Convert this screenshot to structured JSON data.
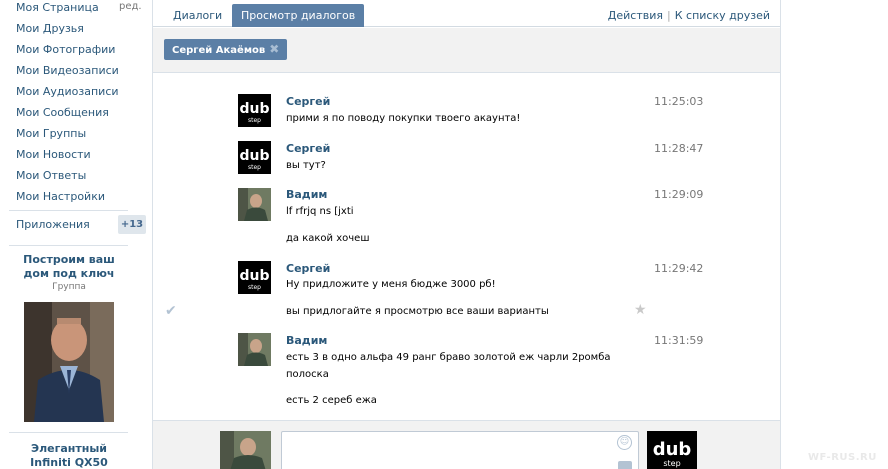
{
  "sidebar": {
    "items": [
      {
        "label": "Моя Страница"
      },
      {
        "label": "Мои Друзья"
      },
      {
        "label": "Мои Фотографии"
      },
      {
        "label": "Мои Видеозаписи"
      },
      {
        "label": "Мои Аудиозаписи"
      },
      {
        "label": "Мои Сообщения"
      },
      {
        "label": "Мои Группы"
      },
      {
        "label": "Мои Новости"
      },
      {
        "label": "Мои Ответы"
      },
      {
        "label": "Мои Настройки"
      }
    ],
    "edit_label": "ред.",
    "apps_label": "Приложения",
    "apps_count": "+13",
    "ad1": {
      "title": "Построим ваш дом под ключ",
      "subtitle": "Группа"
    },
    "ad2": {
      "title": "Элегантный Infiniti QX50"
    }
  },
  "tabs": [
    {
      "label": "Диалоги"
    },
    {
      "label": "Просмотр диалогов"
    }
  ],
  "actions": {
    "actions_label": "Действия",
    "friends_label": "К списку друзей"
  },
  "filter": {
    "chip_label": "Сергей Акаёмов"
  },
  "messages": [
    {
      "name": "Сергей",
      "time": "11:25:03",
      "lines": [
        "прими я по поводу покупки твоего акаунта!"
      ]
    },
    {
      "name": "Сергей",
      "time": "11:28:47",
      "lines": [
        "вы тут?"
      ]
    },
    {
      "name": "Вадим",
      "time": "11:29:09",
      "lines": [
        "lf rfrjq ns [jxti",
        "да какой хочеш"
      ]
    },
    {
      "name": "Сергей",
      "time": "11:29:42",
      "lines": [
        "Ну придложите у меня бюдже 3000 рб!",
        "вы придлогайте я просмотрю все ваши варианты"
      ]
    },
    {
      "name": "Вадим",
      "time": "11:31:59",
      "lines": [
        "есть 3 в одно альфа 49 ранг браво золотой еж чарли 2ромба",
        "полоска",
        "есть 2 сереб ежа"
      ]
    }
  ],
  "icons": {
    "dub_logo_text": "dub",
    "dub_logo_sub": "step",
    "check": "✔",
    "star": "★",
    "smile": "☺"
  },
  "colors": {
    "accent": "#5b7fa6",
    "link": "#2b587a"
  },
  "watermark": "WF-RUS.RU"
}
